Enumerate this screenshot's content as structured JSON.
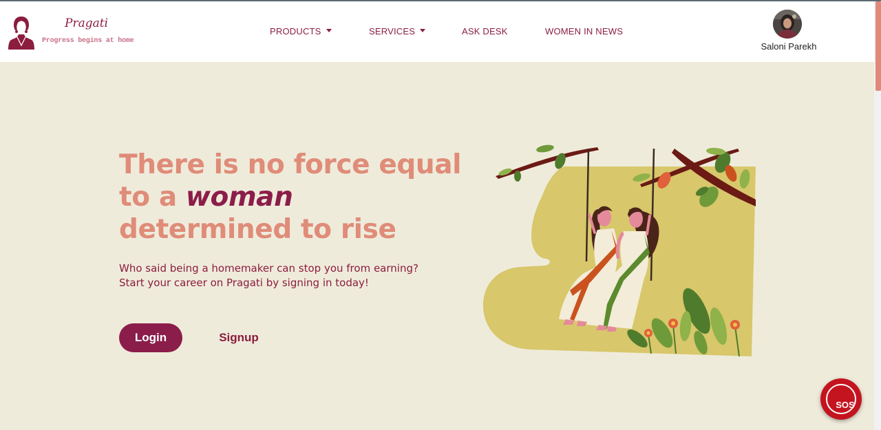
{
  "brand": {
    "name": "Pragati",
    "tagline": "Progress begins at home"
  },
  "nav": {
    "products": "PRODUCTS",
    "services": "SERVICES",
    "ask_desk": "ASK DESK",
    "women_in_news": "WOMEN IN NEWS"
  },
  "profile": {
    "name": "Saloni Parekh"
  },
  "hero": {
    "headline_line1": "There is no force equal",
    "headline_line2_prefix": "to a ",
    "headline_line2_emphasis": "woman",
    "headline_line3": "determined to rise",
    "subtext_line1": "Who said being a homemaker can stop you from earning?",
    "subtext_line2": "Start your career on Pragati by signing in today!",
    "login_label": "Login",
    "signup_label": "Signup"
  },
  "sos": {
    "label": "SOS"
  },
  "icons": {
    "logo": "woman-silhouette-logo-icon",
    "products_caret": "caret-down-icon",
    "services_caret": "caret-down-icon",
    "sos": "sos-phone-icon"
  },
  "colors": {
    "background": "#efebdb",
    "brand": "#8b1d4a",
    "accent": "#df8c79",
    "sos": "#c4141f"
  }
}
